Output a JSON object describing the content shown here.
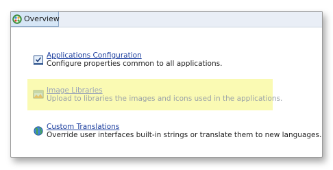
{
  "tabs": {
    "overview_label": "Overview",
    "overview_icon": "overview-icon"
  },
  "items": [
    {
      "title": "Applications Configuration",
      "description": "Configure properties common to all applications.",
      "icon": "checkbox-config-icon",
      "link_color": "#1a3d9e",
      "text_color": "#222222"
    },
    {
      "title": "Image Libraries",
      "description": "Upload to libraries the images and icons used in the applications.",
      "icon": "image-library-icon",
      "highlighted": true,
      "highlight_color": "#fafab3",
      "link_color": "#9aa4b8",
      "text_color": "#9aa2a8"
    },
    {
      "title": "Custom Translations",
      "description": "Override user interfaces built-in strings or translate them to new languages.",
      "icon": "globe-translate-icon",
      "link_color": "#1a3d9e",
      "text_color": "#222222"
    }
  ]
}
